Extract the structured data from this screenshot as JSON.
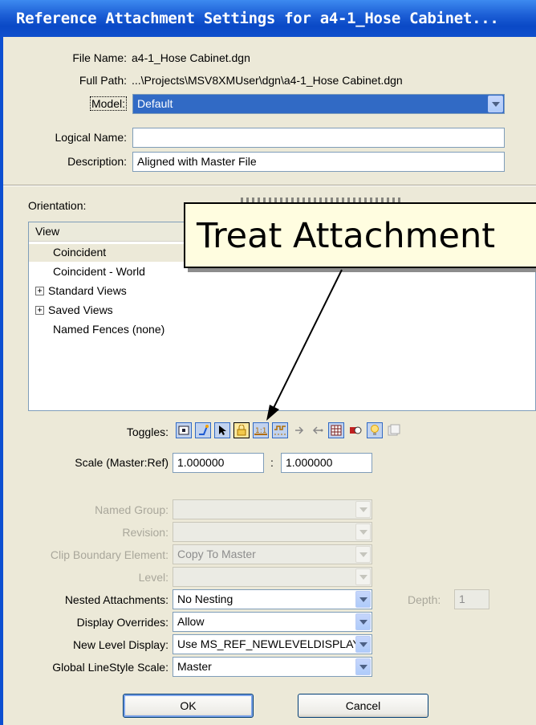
{
  "window": {
    "title": "Reference Attachment Settings for a4-1_Hose Cabinet..."
  },
  "file": {
    "file_name_label": "File Name:",
    "file_name": "a4-1_Hose Cabinet.dgn",
    "full_path_label": "Full Path:",
    "full_path": "...\\Projects\\MSV8XMUser\\dgn\\a4-1_Hose Cabinet.dgn",
    "model_label": "Model:",
    "model_value": "Default",
    "logical_name_label": "Logical Name:",
    "logical_name_value": "",
    "description_label": "Description:",
    "description_value": "Aligned with Master File"
  },
  "orientation": {
    "label": "Orientation:",
    "column_header": "View",
    "items": [
      {
        "label": "Coincident",
        "selected": true
      },
      {
        "label": "Coincident - World"
      },
      {
        "label": "Standard Views",
        "expandable": true
      },
      {
        "label": "Saved Views",
        "expandable": true
      },
      {
        "label": "Named Fences (none)"
      }
    ]
  },
  "tooltip": {
    "text": "Treat Attachment"
  },
  "toggles": {
    "label": "Toggles:",
    "icons": [
      "display-icon",
      "snap-icon",
      "locate-icon",
      "treat-as-element-icon",
      "true-scale-icon",
      "scale-linestyles-icon",
      "display-raster-icon",
      "ignore-attachment-icon",
      "use-lights-icon",
      "display-grid-icon",
      "bulb-icon",
      "reference-icon"
    ]
  },
  "scale": {
    "label": "Scale (Master:Ref)",
    "master": "1.000000",
    "separator": ":",
    "ref": "1.000000"
  },
  "settings": {
    "named_group_label": "Named Group:",
    "revision_label": "Revision:",
    "clip_boundary_label": "Clip Boundary Element:",
    "clip_boundary_value": "Copy To Master",
    "level_label": "Level:",
    "nested_label": "Nested Attachments:",
    "nested_value": "No Nesting",
    "depth_label": "Depth:",
    "depth_value": "1",
    "display_overrides_label": "Display Overrides:",
    "display_overrides_value": "Allow",
    "new_level_label": "New Level Display:",
    "new_level_value": "Use MS_REF_NEWLEVELDISPLAY",
    "global_linestyle_label": "Global LineStyle Scale:",
    "global_linestyle_value": "Master"
  },
  "buttons": {
    "ok": "OK",
    "cancel": "Cancel"
  },
  "colors": {
    "title_bar": "#0a49c6",
    "selection": "#ece9d8",
    "tooltip_bg": "#fffde0"
  }
}
